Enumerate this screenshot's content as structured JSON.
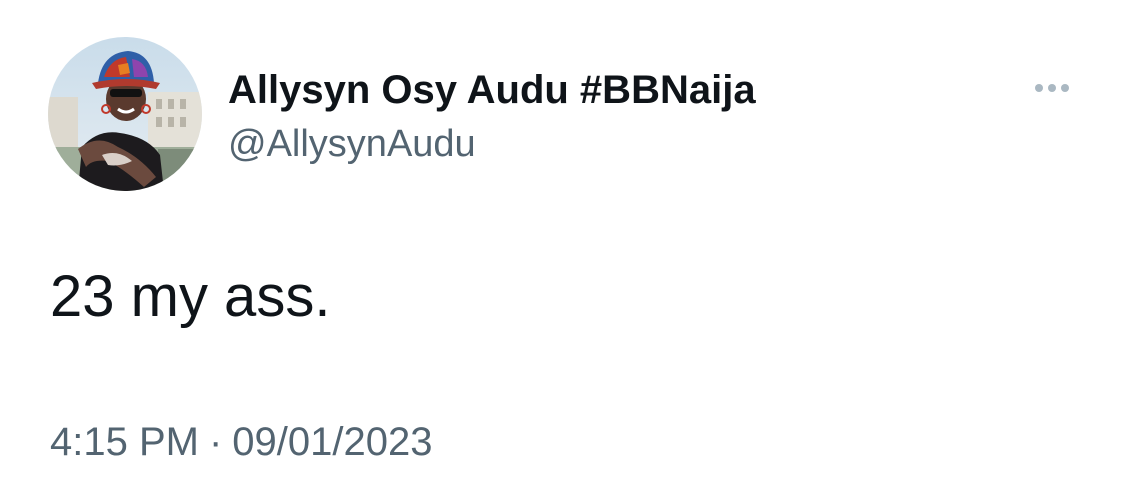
{
  "tweet": {
    "author": {
      "display_name": "Allysyn Osy Audu #BBNaija",
      "handle": "@AllysynAudu"
    },
    "text": "23 my ass.",
    "time": "4:15 PM",
    "separator": "·",
    "date": "09/01/2023",
    "more_icon": "more-horizontal-icon"
  },
  "colors": {
    "name": "#0f1419",
    "secondary": "#536471",
    "more_dots": "#aab8c2",
    "background": "#ffffff"
  }
}
